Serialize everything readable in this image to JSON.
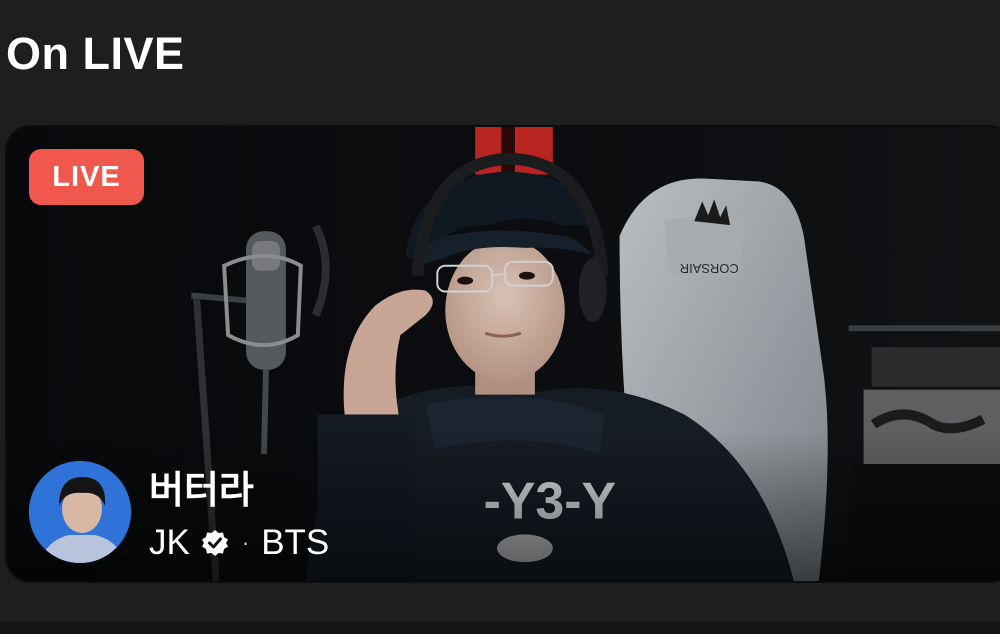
{
  "section": {
    "title": "On LIVE"
  },
  "live_card": {
    "badge": "LIVE",
    "broadcast_title": "버터라",
    "artist_name": "JK",
    "separator": "·",
    "group_name": "BTS",
    "verified_icon": "verified-badge-icon",
    "chair_brand": "CORSAIR"
  },
  "colors": {
    "background": "#1e1e1e",
    "live_badge": "#f0574d",
    "avatar_bg": "#2f73d8"
  }
}
